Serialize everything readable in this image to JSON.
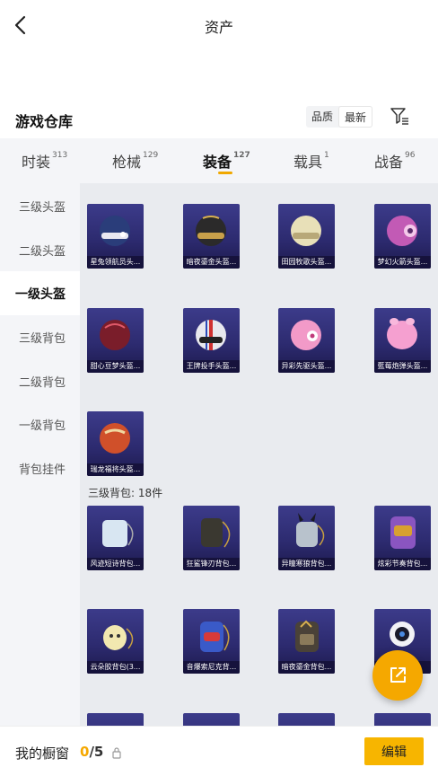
{
  "header": {
    "title": "资产"
  },
  "warehouse": {
    "title": "游戏仓库",
    "sort_options": [
      "品质",
      "最新"
    ],
    "active_sort": "最新"
  },
  "tabs": [
    {
      "label": "时装",
      "count": "313"
    },
    {
      "label": "枪械",
      "count": "129"
    },
    {
      "label": "装备",
      "count": "127"
    },
    {
      "label": "载具",
      "count": "1"
    },
    {
      "label": "战备",
      "count": "96"
    }
  ],
  "sidebar": {
    "items": [
      "三级头盔",
      "二级头盔",
      "一级头盔",
      "三级背包",
      "二级背包",
      "一级背包",
      "背包挂件"
    ],
    "active": "一级头盔"
  },
  "helmets": [
    {
      "label": "星兔领航员头...",
      "color": "#2a3d7a"
    },
    {
      "label": "暗夜鎏金头盔...",
      "color": "#2b2a2a"
    },
    {
      "label": "田园牧歌头盔...",
      "color": "#e8e0b8"
    },
    {
      "label": "梦幻火箭头盔...",
      "color": "#c25ab5"
    },
    {
      "label": "甜心豆梦头盔...",
      "color": "#7a1d2a"
    },
    {
      "label": "王牌投手头盔...",
      "color": "#e8e8ee"
    },
    {
      "label": "异彩先驱头盔...",
      "color": "#f29ac8"
    },
    {
      "label": "藍莓炮弹头盔...",
      "color": "#f5a0d0"
    },
    {
      "label": "瑞龙福将头盔...",
      "color": "#d0502a"
    }
  ],
  "section": {
    "label": "三级背包: 18件"
  },
  "backpacks": [
    {
      "label": "风迹短诗背包...",
      "color": "#d8e6f2"
    },
    {
      "label": "狂鲨锋刃背包...",
      "color": "#3a3830"
    },
    {
      "label": "异瞳寒狼背包...",
      "color": "#b8c2cc"
    },
    {
      "label": "炫彩节奏背包...",
      "color": "#8a55c0"
    },
    {
      "label": "云朵胶背包(3...",
      "color": "#f2e8b0"
    },
    {
      "label": "音爆索尼克背...",
      "color": "#3a5ac8"
    },
    {
      "label": "暗夜鎏金背包...",
      "color": "#4a4238"
    },
    {
      "label": "",
      "color": "#1a1a2a"
    }
  ],
  "bottom_bar": {
    "label": "我的橱窗",
    "current": "0",
    "total": "/5",
    "edit_label": "编辑"
  },
  "accent_color": "#f5a800"
}
